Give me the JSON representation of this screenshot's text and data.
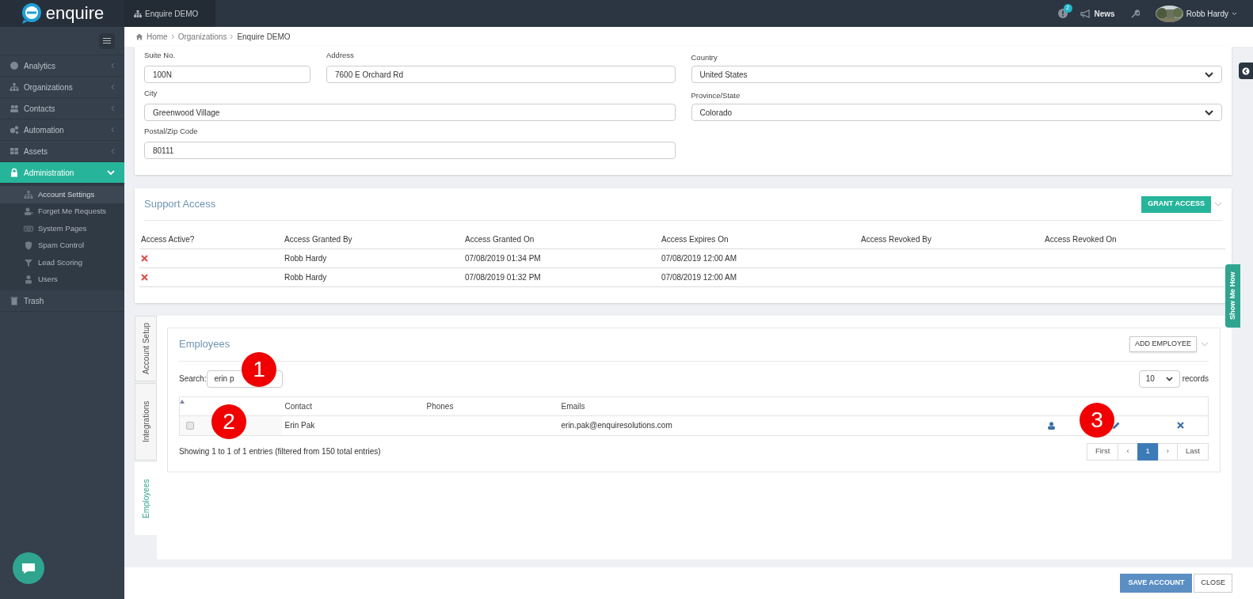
{
  "topbar": {
    "logo_text": "enquire",
    "org_tab": "Enquire DEMO",
    "notification_count": "2",
    "news": "News",
    "user": "Robb Hardy"
  },
  "sidebar": {
    "items": [
      {
        "label": "Analytics",
        "selected": false,
        "expanded": false
      },
      {
        "label": "Organizations",
        "selected": false,
        "expanded": false
      },
      {
        "label": "Contacts",
        "selected": false,
        "expanded": false
      },
      {
        "label": "Automation",
        "selected": false,
        "expanded": false
      },
      {
        "label": "Assets",
        "selected": false,
        "expanded": false
      },
      {
        "label": "Administration",
        "selected": true,
        "expanded": true,
        "children": [
          {
            "label": "Account Settings",
            "selected": true
          },
          {
            "label": "Forget Me Requests",
            "selected": false
          },
          {
            "label": "System Pages",
            "selected": false
          },
          {
            "label": "Spam Control",
            "selected": false
          },
          {
            "label": "Lead Scoring",
            "selected": false
          },
          {
            "label": "Users",
            "selected": false
          }
        ]
      },
      {
        "label": "Trash",
        "selected": false
      }
    ]
  },
  "breadcrumb": [
    "Home",
    "Organizations",
    "Enquire DEMO"
  ],
  "address_form": {
    "left": [
      [
        {
          "label": "Suite No.",
          "value": "100N",
          "kind": "text"
        },
        {
          "label": "Address",
          "value": "7600 E Orchard Rd",
          "kind": "text"
        }
      ],
      [
        {
          "label": "City",
          "value": "Greenwood Village",
          "kind": "text"
        }
      ],
      [
        {
          "label": "Postal/Zip Code",
          "value": "80111",
          "kind": "text"
        }
      ]
    ],
    "right": [
      [
        {
          "label": "Country",
          "value": "United States",
          "kind": "select"
        }
      ],
      [
        {
          "label": "Province/State",
          "value": "Colorado",
          "kind": "select"
        }
      ]
    ]
  },
  "support_access": {
    "title": "Support Access",
    "button": "GRANT ACCESS",
    "columns": [
      "Access Active?",
      "Access Granted By",
      "Access Granted On",
      "Access Expires On",
      "Access Revoked By",
      "Access Revoked On"
    ],
    "rows": [
      {
        "active": false,
        "granted_by": "Robb Hardy",
        "granted_on": "07/08/2019 01:34 PM",
        "expires_on": "07/08/2019 12:00 AM"
      },
      {
        "active": false,
        "granted_by": "Robb Hardy",
        "granted_on": "07/08/2019 01:32 PM",
        "expires_on": "07/08/2019 12:00 AM"
      }
    ]
  },
  "side_tabs": [
    {
      "label": "Account Setup",
      "selected": false
    },
    {
      "label": "Integrations",
      "selected": false
    },
    {
      "label": "Employees",
      "selected": true
    }
  ],
  "employees": {
    "title": "Employees",
    "button": "ADD EMPLOYEE",
    "search_label": "Search:",
    "search_value": "erin p",
    "page_size": "10",
    "records_label": "records",
    "columns": [
      "Contact",
      "Phones",
      "Emails"
    ],
    "rows": [
      {
        "checked": false,
        "contact": "Erin Pak",
        "email": "erin.pak@enquiresolutions.com"
      }
    ],
    "info": "Showing 1 to 1 of 1 entries (filtered from 150 total entries)",
    "pagination": [
      {
        "label": "First",
        "selected": false
      },
      {
        "label": "‹",
        "selected": false
      },
      {
        "label": "1",
        "selected": true
      },
      {
        "label": "›",
        "selected": false
      },
      {
        "label": "Last",
        "selected": false
      }
    ]
  },
  "callouts": [
    "1",
    "2",
    "3"
  ],
  "show_me_how": "Show Me How",
  "footer": {
    "save": "SAVE ACCOUNT",
    "close": "CLOSE"
  }
}
